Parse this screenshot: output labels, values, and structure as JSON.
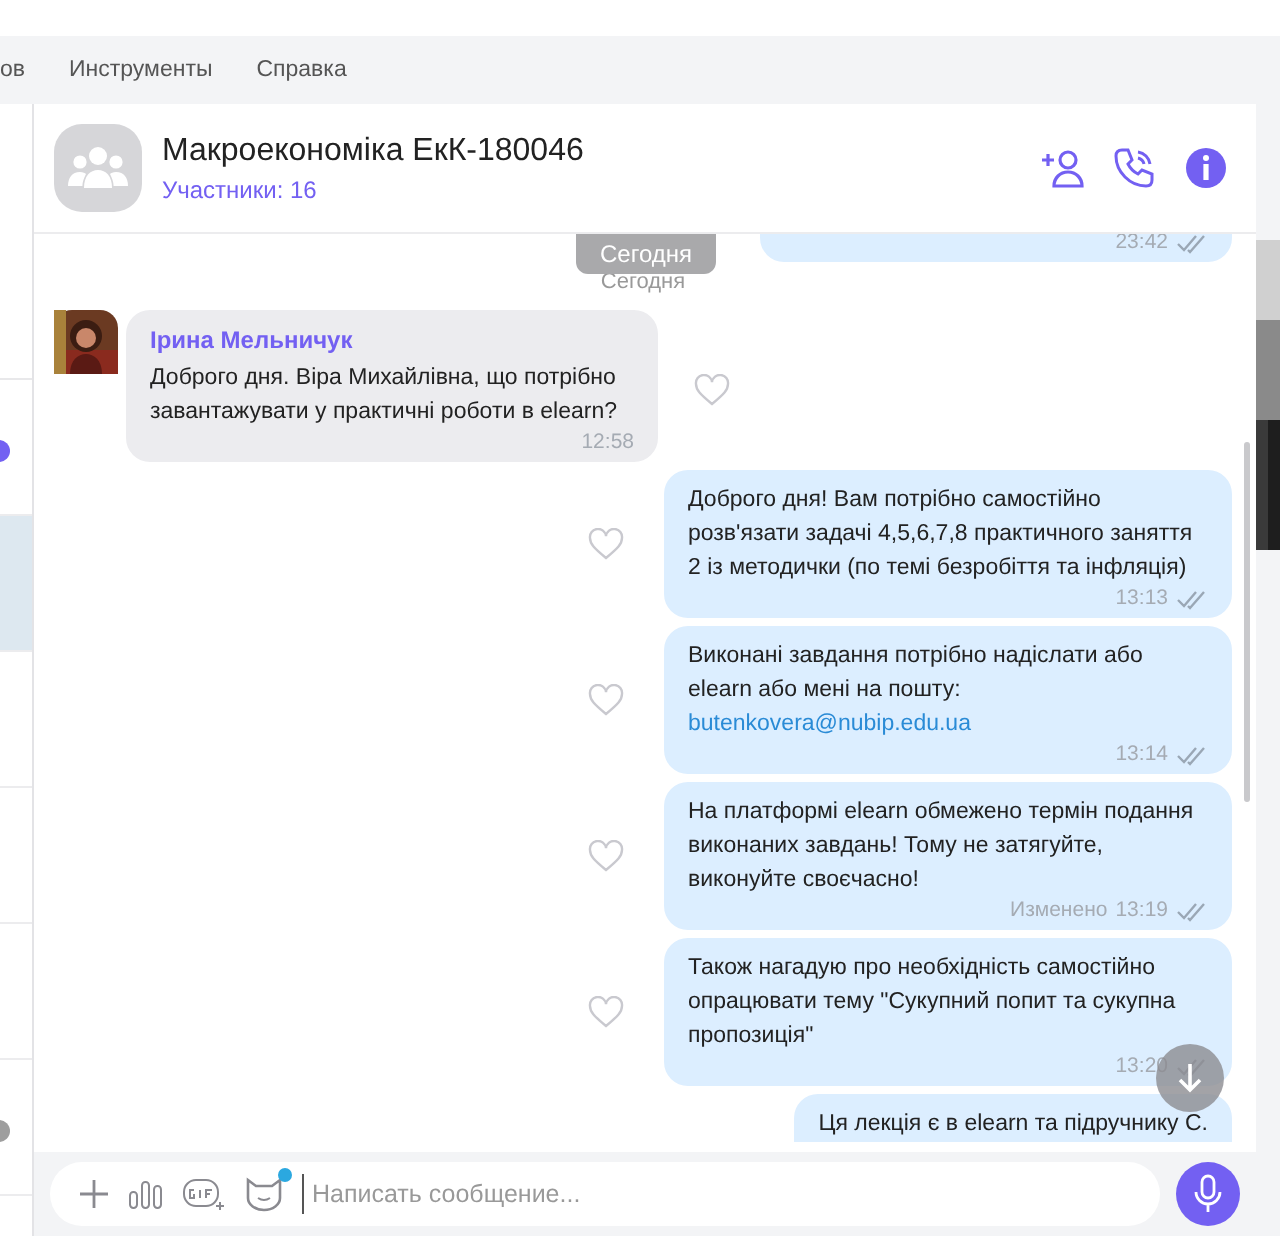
{
  "menu": [
    {
      "label": "ов"
    },
    {
      "label": "Инструменты"
    },
    {
      "label": "Справка"
    }
  ],
  "sidebar": {
    "items": [
      {
        "selected": false,
        "color": "#7360f2"
      },
      {
        "selected": true
      },
      {
        "selected": false
      },
      {
        "selected": false
      },
      {
        "selected": false
      },
      {
        "selected": false,
        "color": "#9e9e9e"
      }
    ]
  },
  "header": {
    "title": "Макроекономіка ЕкК-180046",
    "subtitle": "Участники: 16"
  },
  "date_pill": "Сегодня",
  "date_label": "Сегодня",
  "messages": [
    {
      "kind": "outgoing",
      "time": "23:42",
      "read": true
    },
    {
      "kind": "incoming",
      "sender": "Ірина Мельничук",
      "text": "Доброго дня. Віра Михайлівна, що потрібно завантажувати у практичні роботи в elearn?",
      "time": "12:58"
    },
    {
      "kind": "outgoing",
      "text": "Доброго дня! Вам потрібно самостійно розв'язати задачі 4,5,6,7,8 практичного заняття 2 із методички (по темі безробіття та інфляція)",
      "time": "13:13",
      "read": true
    },
    {
      "kind": "outgoing",
      "text": "Виконані завдання потрібно надіслати або elearn або мені на пошту:",
      "link": "butenkovera@nubip.edu.ua",
      "time": "13:14",
      "read": true
    },
    {
      "kind": "outgoing",
      "text": "На платформі elearn обмежено термін подання виконаних завдань! Тому не затягуйте, виконуйте своєчасно!",
      "edited": "Изменено",
      "time": "13:19",
      "read": true
    },
    {
      "kind": "outgoing",
      "text": "Також нагадую про необхідність самостійно опрацювати тему \"Сукупний попит  та сукупна пропозиція\"",
      "time": "13:20",
      "read": true
    },
    {
      "kind": "outgoing",
      "text": "Ця лекція є в elearn та підручнику  С."
    }
  ],
  "composer": {
    "placeholder": "Написать сообщение...",
    "sticker_badge": true
  }
}
